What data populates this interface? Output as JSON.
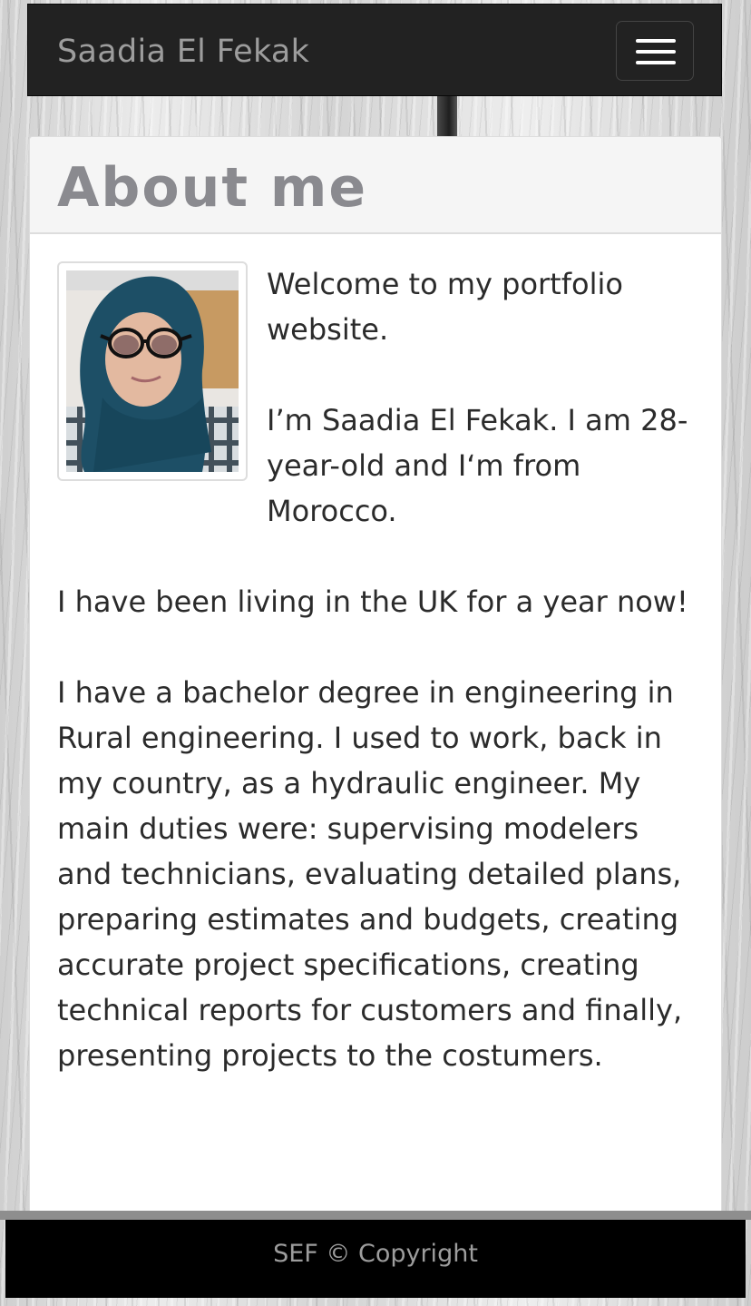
{
  "navbar": {
    "brand": "Saadia El Fekak",
    "toggle_icon": "hamburger-menu-icon"
  },
  "about": {
    "title": "About me",
    "paragraphs": [
      "Welcome to my portfolio website.",
      "I’m Saadia El Fekak. I am 28-year-old and I‘m from Morocco.",
      "I have been living in the UK for a year now!",
      "I have a bachelor degree in engineering in Rural engineering. I used to work, back in my country, as a hydraulic engineer. My main duties were: supervising modelers and technicians, evaluating detailed plans, preparing estimates and budgets, creating accurate project specifications, creating technical reports for customers and finally, presenting projects to the costumers."
    ]
  },
  "footer": {
    "text": "SEF © Copyright"
  }
}
